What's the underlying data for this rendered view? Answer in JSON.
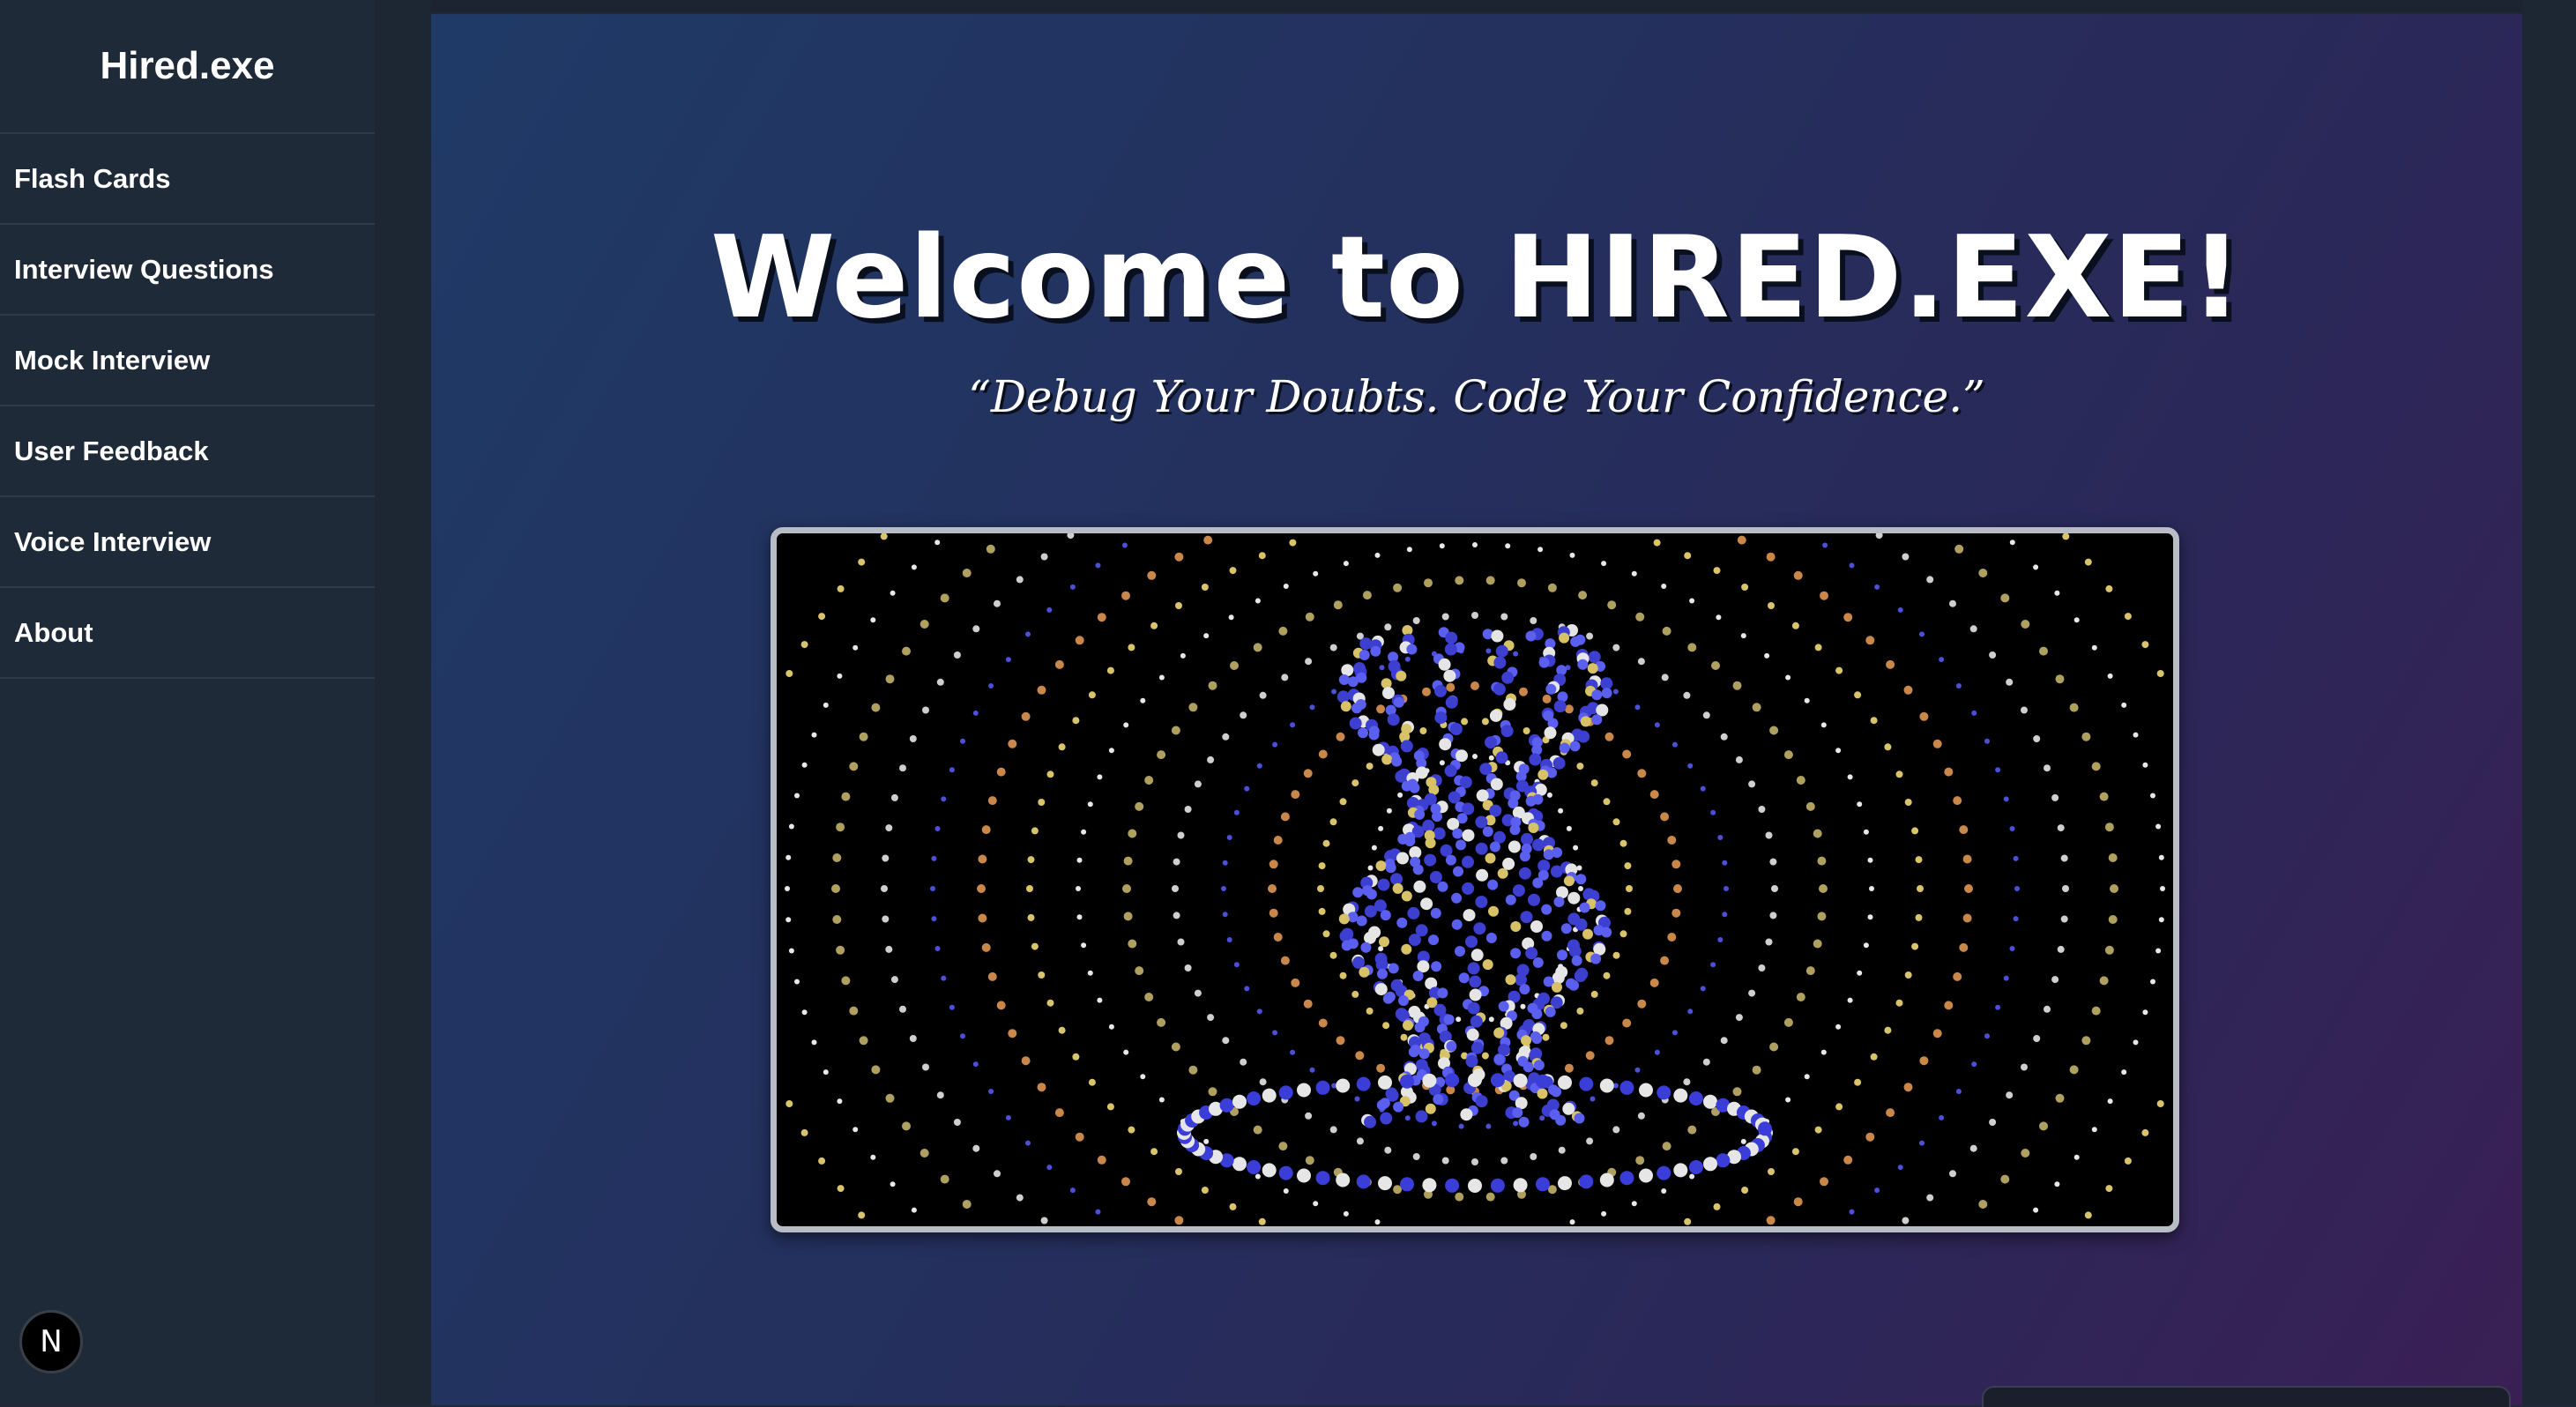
{
  "sidebar": {
    "brand": "Hired.exe",
    "items": [
      {
        "label": "Flash Cards"
      },
      {
        "label": "Interview Questions"
      },
      {
        "label": "Mock Interview"
      },
      {
        "label": "User Feedback"
      },
      {
        "label": "Voice Interview"
      },
      {
        "label": "About"
      }
    ]
  },
  "main": {
    "title": "Welcome to HIRED.EXE!",
    "tagline": "“Debug Your Doubts. Code Your Confidence.”",
    "hero_media": "animated-particle-spiral"
  },
  "dev_indicator": {
    "glyph": "N",
    "icon": "nextjs-icon"
  },
  "colors": {
    "sidebar_bg": "#1f2a38",
    "main_gradient_start": "#1f3a66",
    "main_gradient_end": "#3a1f55",
    "text": "#ffffff"
  }
}
